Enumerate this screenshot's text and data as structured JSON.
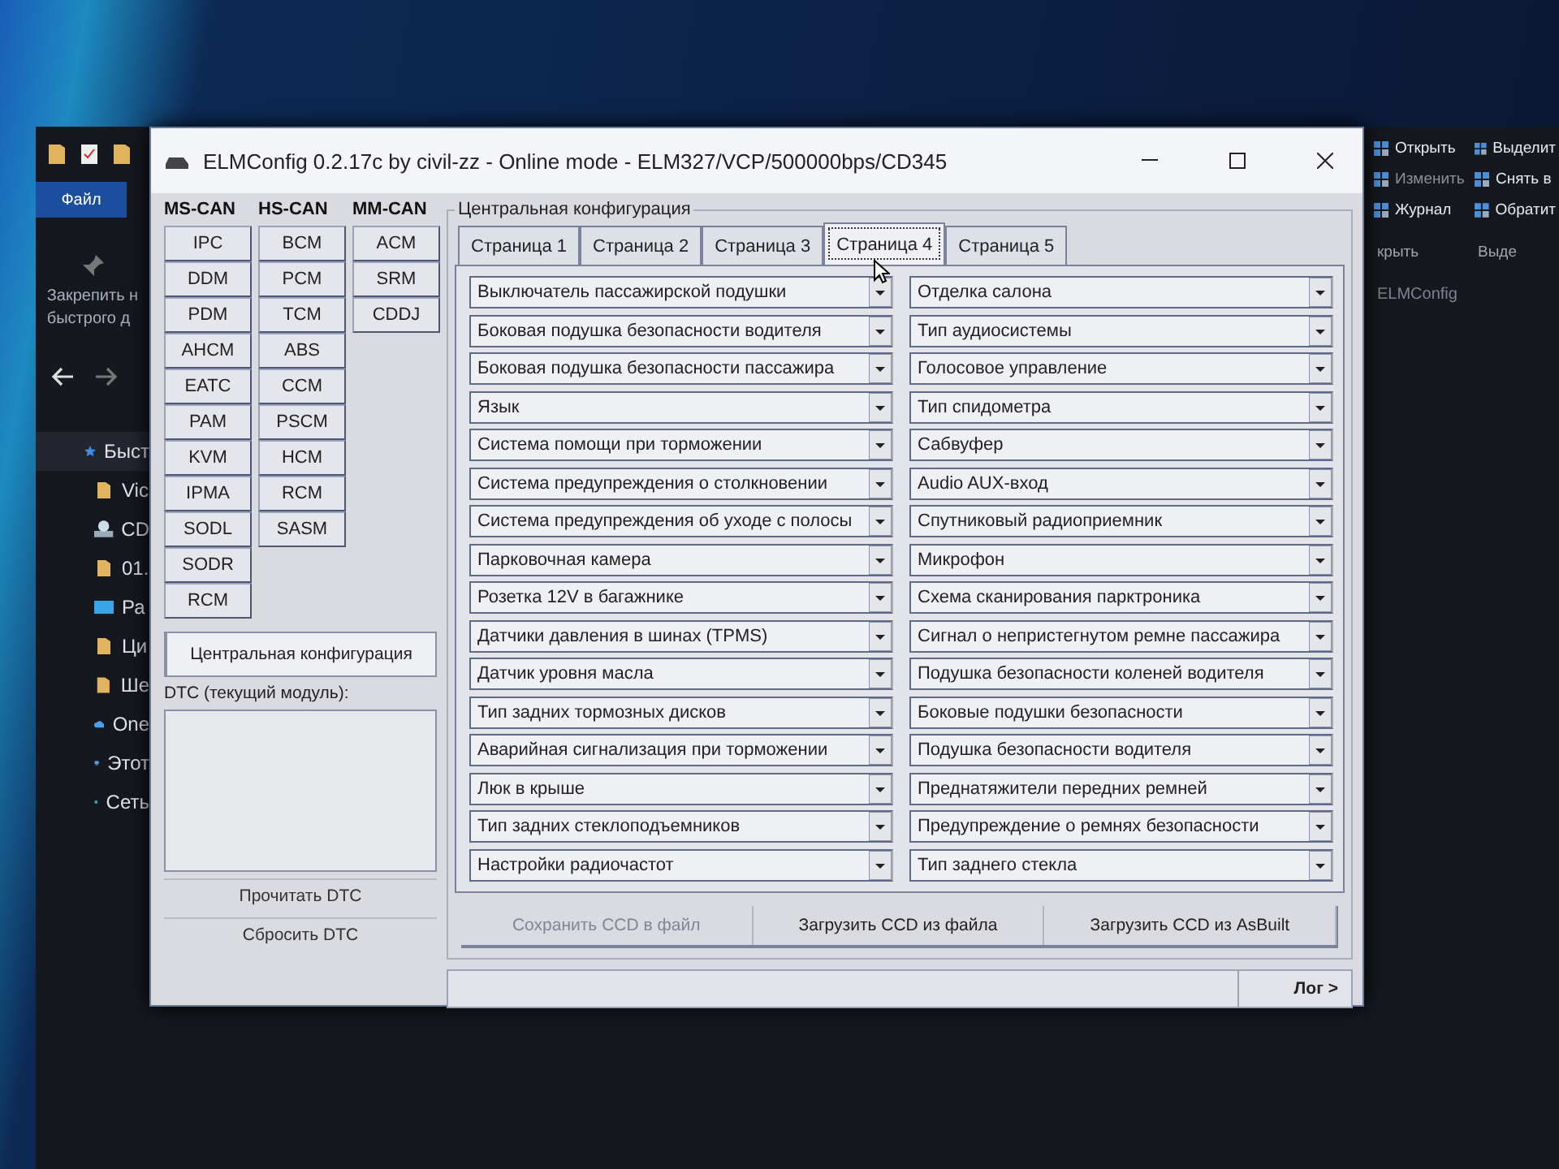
{
  "explorer": {
    "file_tab": "Файл",
    "pin_lines": [
      "Закрепить н",
      "быстрого д"
    ],
    "nav": [
      {
        "kind": "star",
        "label": "Быст",
        "selected": true
      },
      {
        "kind": "folder",
        "label": "Vic",
        "selected": false
      },
      {
        "kind": "disc",
        "label": "CD",
        "selected": false
      },
      {
        "kind": "folder",
        "label": "01.",
        "selected": false
      },
      {
        "kind": "desktop",
        "label": "Ра",
        "selected": false
      },
      {
        "kind": "folder",
        "label": "Ци",
        "selected": false
      },
      {
        "kind": "folder",
        "label": "Ше",
        "selected": false
      },
      {
        "kind": "cloud",
        "label": "One",
        "selected": false
      },
      {
        "kind": "pc",
        "label": "Этот",
        "selected": false
      },
      {
        "kind": "network",
        "label": "Сеть",
        "selected": false
      }
    ],
    "ribbon": [
      {
        "label": "Открыть",
        "disabled": false
      },
      {
        "label": "Выделит",
        "disabled": false
      },
      {
        "label": "Изменить",
        "disabled": true
      },
      {
        "label": "Снять в",
        "disabled": false
      },
      {
        "label": "Журнал",
        "disabled": false
      },
      {
        "label": "Обратит",
        "disabled": false
      }
    ],
    "ribbon_groups": [
      "крыть",
      "Выде"
    ],
    "address": "ELMConfig"
  },
  "window": {
    "title": "ELMConfig 0.2.17c by civil-zz - Online mode - ELM327/VCP/500000bps/CD345",
    "can_groups": [
      {
        "title": "MS-CAN",
        "modules": [
          "IPC",
          "DDM",
          "PDM",
          "AHCM",
          "EATC",
          "PAM",
          "KVM",
          "IPMA",
          "SODL",
          "SODR",
          "RCM"
        ]
      },
      {
        "title": "HS-CAN",
        "modules": [
          "BCM",
          "PCM",
          "TCM",
          "ABS",
          "CCM",
          "PSCM",
          "HCM",
          "RCM",
          "SASM"
        ]
      },
      {
        "title": "MM-CAN",
        "modules": [
          "ACM",
          "SRM",
          "CDDJ"
        ]
      }
    ],
    "central_button": {
      "label": "Центральная конфигурация",
      "selected": true
    },
    "dtc_label": "DTC (текущий модуль):",
    "dtc_buttons": [
      "Прочитать DTC",
      "Сбросить DTC"
    ],
    "config": {
      "title": "Центральная конфигурация",
      "tabs": [
        {
          "label": "Страница 1",
          "selected": false
        },
        {
          "label": "Страница 2",
          "selected": false
        },
        {
          "label": "Страница 3",
          "selected": false
        },
        {
          "label": "Страница 4",
          "selected": true
        },
        {
          "label": "Страница 5",
          "selected": false
        }
      ],
      "left_options": [
        "Выключатель пассажирской подушки",
        "Боковая подушка безопасности водителя",
        "Боковая подушка безопасности пассажира",
        "Язык",
        "Система помощи при торможении",
        "Система предупреждения о столкновении",
        "Система предупреждения об уходе с полосы",
        "Парковочная камера",
        "Розетка 12V в багажнике",
        "Датчики давления в шинах (TPMS)",
        "Датчик уровня масла",
        "Тип задних тормозных дисков",
        "Аварийная сигнализация при торможении",
        "Люк в крыше",
        "Тип задних стеклоподъемников",
        "Настройки радиочастот"
      ],
      "right_options": [
        "Отделка салона",
        "Тип аудиосистемы",
        "Голосовое управление",
        "Тип спидометра",
        "Сабвуфер",
        "Audio AUX-вход",
        "Спутниковый радиоприемник",
        "Микрофон",
        "Схема сканирования парктроника",
        "Сигнал о непристегнутом ремне пассажира",
        "Подушка безопасности коленей водителя",
        "Боковые подушки безопасности",
        "Подушка безопасности водителя",
        "Преднатяжители передних ремней",
        "Предупреждение о ремнях безопасности",
        "Тип заднего стекла"
      ],
      "actions": [
        {
          "label": "Сохранить CCD в файл",
          "disabled": true
        },
        {
          "label": "Загрузить CCD из файла",
          "disabled": false
        },
        {
          "label": "Загрузить CCD из AsBuilt",
          "disabled": false
        }
      ]
    },
    "log_button": "Лог >"
  }
}
